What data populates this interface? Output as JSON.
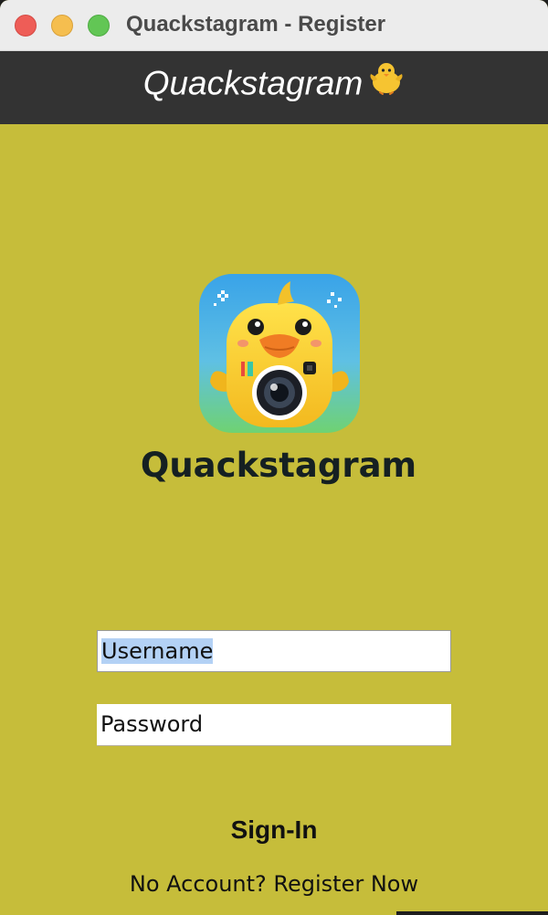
{
  "window": {
    "title": "Quackstagram - Register",
    "controls": [
      "close",
      "minimize",
      "maximize"
    ]
  },
  "header": {
    "title": "Quackstagram",
    "emoji_icon": "chick-emoji",
    "background": "#333333"
  },
  "logo": {
    "icon": "duck-with-camera-app-icon",
    "brand_name": "Quackstagram"
  },
  "form": {
    "username_value": "Username",
    "password_value": "Password",
    "signin_label": "Sign-In",
    "register_label": "No Account? Register Now"
  },
  "colors": {
    "background": "#c6bd3a",
    "header": "#333333",
    "selection": "#b3d1f5"
  }
}
